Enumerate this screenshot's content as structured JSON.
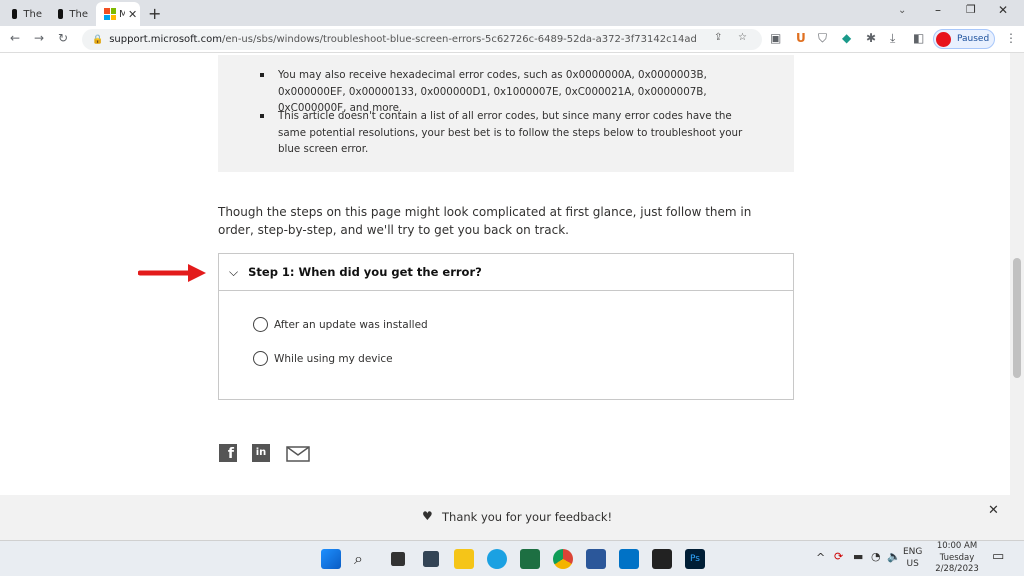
{
  "browser": {
    "tabs": [
      {
        "label": "The"
      },
      {
        "label": "The"
      },
      {
        "label": "Microsoft Support"
      }
    ],
    "url_host": "support.microsoft.com",
    "url_path": "/en-us/sbs/windows/troubleshoot-blue-screen-errors-5c62726c-6489-52da-a372-3f73142c14ad",
    "profile_label": "Paused"
  },
  "article": {
    "bullets": [
      "You may also receive hexadecimal error codes, such as 0x0000000A, 0x0000003B, 0x000000EF, 0x00000133, 0x000000D1, 0x1000007E, 0xC000021A, 0x0000007B, 0xC000000F, and more.",
      "This article doesn't contain a list of all error codes, but since many error codes have the same potential resolutions, your best bet is to follow the steps below to troubleshoot your blue screen error."
    ],
    "intro": "Though the steps on this page might look complicated at first glance, just follow them in order, step-by-step, and we'll try to get you back on track.",
    "step_title": "Step 1: When did you get the error?",
    "options": [
      "After an update was installed",
      "While using my device"
    ]
  },
  "feedback": {
    "text": "Thank you for your feedback!"
  },
  "taskbar": {
    "lang": "ENG",
    "region": "US",
    "time": "10:00 AM",
    "day": "Tuesday",
    "date": "2/28/2023"
  },
  "colors": {
    "arrow": "#e31b1b",
    "accent": "#0067b8"
  }
}
